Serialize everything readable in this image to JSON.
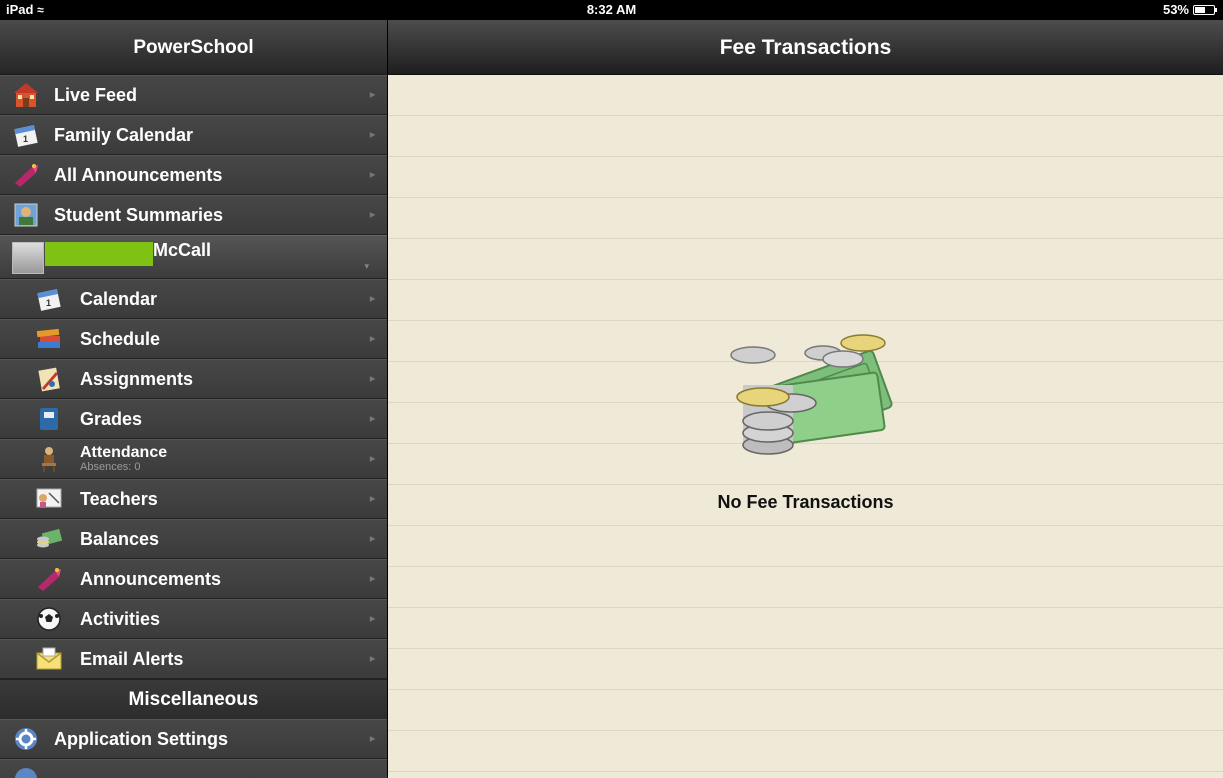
{
  "status_bar": {
    "device": "iPad",
    "time": "8:32 AM",
    "battery": "53%",
    "battery_level": 0.53,
    "wifi_icon": "wifi-icon"
  },
  "sidebar": {
    "title": "PowerSchool",
    "top_items": [
      {
        "label": "Live Feed",
        "icon": "school-house-icon"
      },
      {
        "label": "Family Calendar",
        "icon": "calendar-icon"
      },
      {
        "label": "All Announcements",
        "icon": "megaphone-icon"
      },
      {
        "label": "Student Summaries",
        "icon": "student-icon"
      }
    ],
    "student": {
      "name": "McCall"
    },
    "student_items": [
      {
        "label": "Calendar",
        "icon": "calendar-icon"
      },
      {
        "label": "Schedule",
        "icon": "books-icon"
      },
      {
        "label": "Assignments",
        "icon": "assignments-icon"
      },
      {
        "label": "Grades",
        "icon": "gradebook-icon"
      },
      {
        "label": "Attendance",
        "sublabel": "Absences: 0",
        "icon": "attendance-icon"
      },
      {
        "label": "Teachers",
        "icon": "teachers-icon"
      },
      {
        "label": "Balances",
        "icon": "money-icon"
      },
      {
        "label": "Announcements",
        "icon": "megaphone-icon"
      },
      {
        "label": "Activities",
        "icon": "soccer-ball-icon"
      },
      {
        "label": "Email Alerts",
        "icon": "envelope-icon"
      }
    ],
    "misc_section": "Miscellaneous",
    "misc_items": [
      {
        "label": "Application Settings",
        "icon": "gear-icon"
      }
    ]
  },
  "main": {
    "title": "Fee Transactions",
    "empty_message": "No Fee Transactions",
    "illustration": "money-coins-icon"
  }
}
